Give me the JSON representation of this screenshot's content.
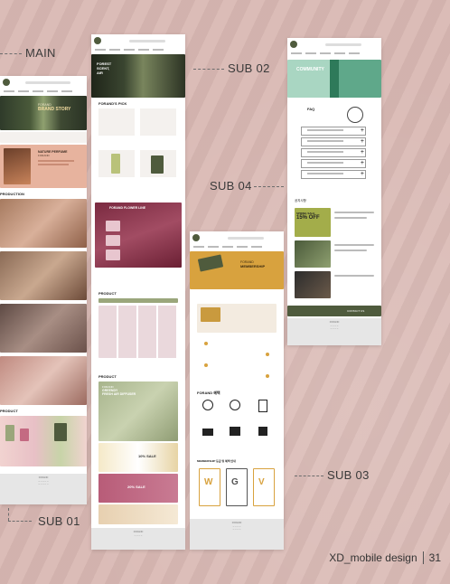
{
  "labels": {
    "main": "MAIN",
    "sub01": "SUB 01",
    "sub02": "SUB 02",
    "sub03": "SUB 03",
    "sub04": "SUB 04",
    "footer_title": "XD_mobile design",
    "page_number": "31"
  },
  "main": {
    "brand_title": "FORAND",
    "brand_sub": "BRAND STORY",
    "nature_title": "NATURE PERFUME",
    "nature_sub": "FORAND",
    "production": "PRODUCTION",
    "product": "PRODUCT"
  },
  "sub01": {
    "pick_title": "FORAND'S PICK",
    "hero_line1": "FOREST",
    "hero_line2": "SCENT,",
    "hero_line3": "AIR",
    "flower_line": "FORAND FLOWER LINE",
    "product": "PRODUCT",
    "product2": "PRODUCT",
    "diffuser_title": "FORAND",
    "diffuser_line1": "GREENDY",
    "diffuser_line2": "FRESH AIR DIFFUSER",
    "sale": "10% SALE",
    "sale2": "20% SALE"
  },
  "sub03": {
    "membership_title": "FORAND",
    "membership_sub": "MEMBERSHIP",
    "benefit_title": "FORAND 혜택",
    "grade_title": "MEMBERSHIP 등급 및 혜택 안내",
    "grades": [
      "W",
      "G",
      "V"
    ]
  },
  "sub04": {
    "community": "COMMUNITY",
    "faq": "FAQ",
    "notice": "공지사항",
    "spring_sale": "SPRING SALE",
    "off": "15% OFF",
    "contact": "CONTACT US"
  },
  "colors": {
    "background": "#d9b8b3",
    "olive": "#4f5b3d",
    "mint": "#a9d6c2",
    "mauve": "#a24c63",
    "sage": "#9aa67b"
  }
}
